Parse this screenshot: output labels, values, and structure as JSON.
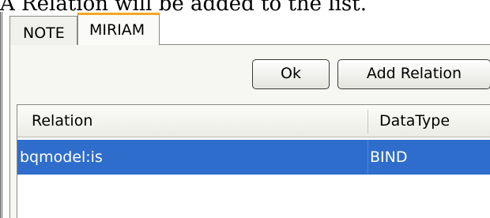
{
  "caption": "A Relation will be added to the list.",
  "tabs": [
    {
      "label": "NOTE",
      "selected": false
    },
    {
      "label": "MIRIAM",
      "selected": true
    }
  ],
  "buttons": {
    "ok_label": "Ok",
    "add_relation_label": "Add Relation"
  },
  "table": {
    "columns": [
      "Relation",
      "DataType"
    ],
    "rows": [
      {
        "relation": "bqmodel:is",
        "datatype": "BIND",
        "selected": true
      }
    ]
  },
  "colors": {
    "selection": "#2f6dcc",
    "active_tab_accent": "#f5a623"
  }
}
